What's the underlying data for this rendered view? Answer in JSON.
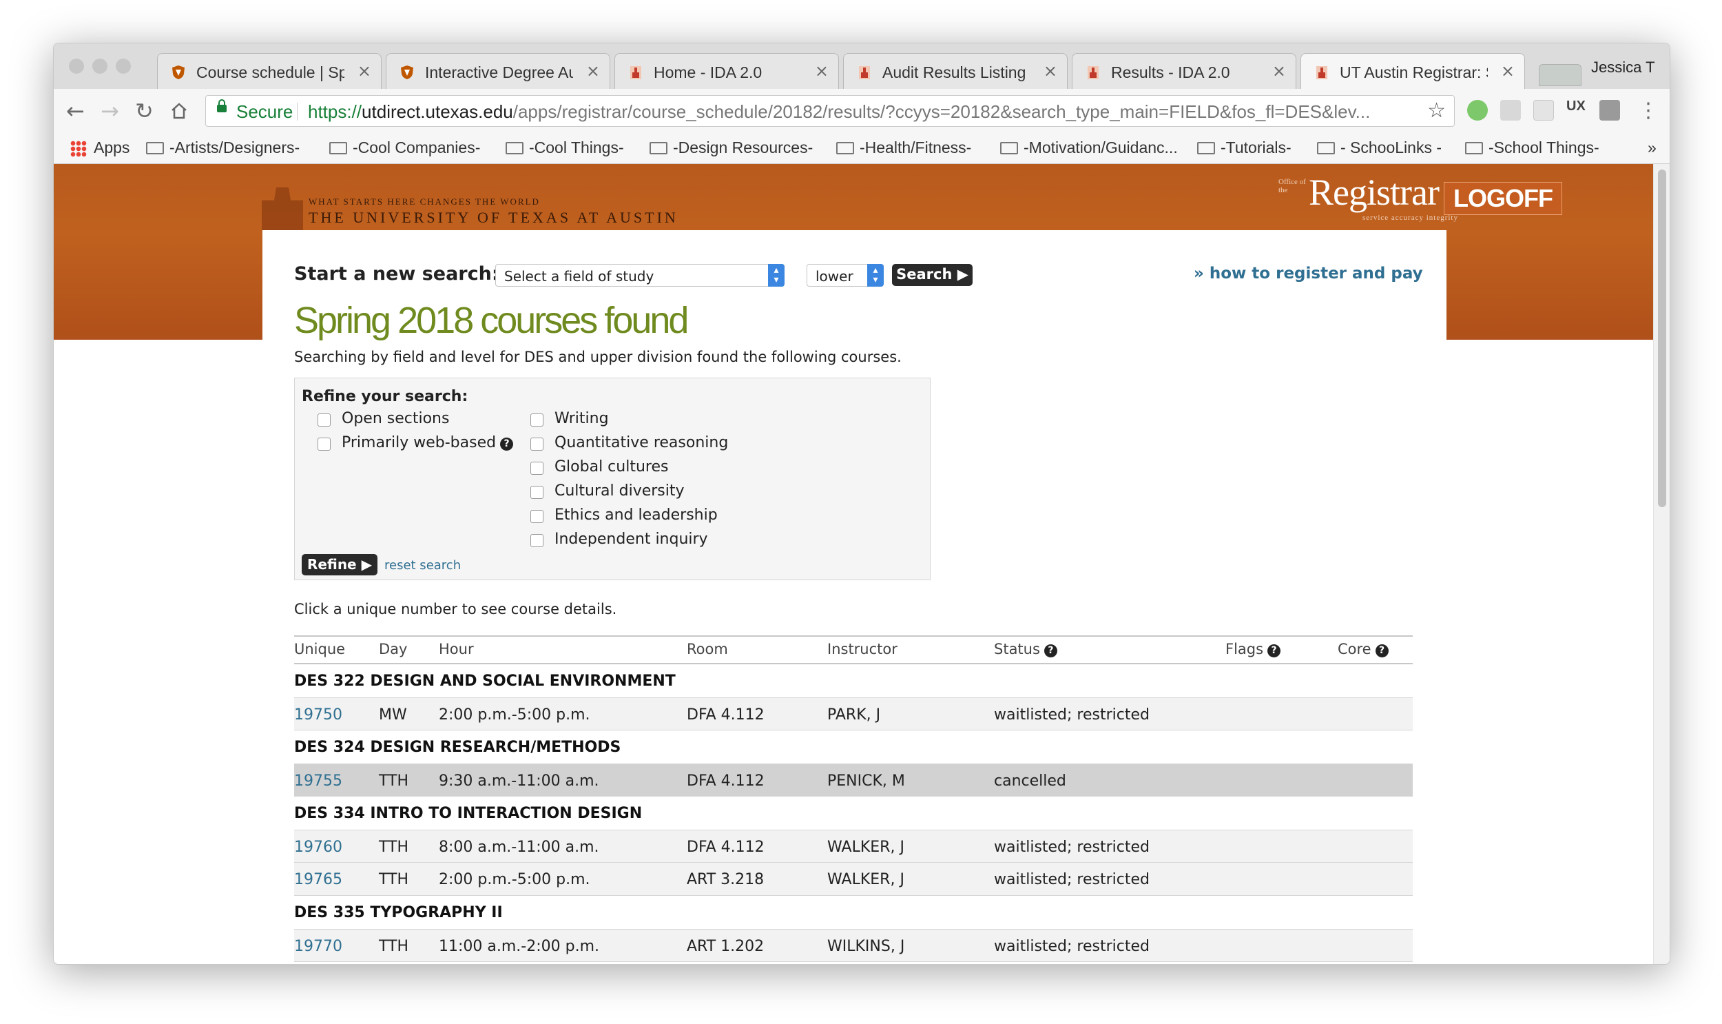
{
  "browser": {
    "tabs": [
      {
        "title": "Course schedule | Spr"
      },
      {
        "title": "Interactive Degree Au"
      },
      {
        "title": "Home - IDA 2.0"
      },
      {
        "title": "Audit Results Listing -"
      },
      {
        "title": "Results - IDA 2.0"
      },
      {
        "title": "UT Austin Registrar: S"
      }
    ],
    "tab_close": "×",
    "profile_name": "Jessica T",
    "secure_label": "Secure",
    "url_scheme": "https://",
    "url_domain": "utdirect.utexas.edu",
    "url_path": "/apps/registrar/course_schedule/20182/results/?ccyys=20182&search_type_main=FIELD&fos_fl=DES&lev...",
    "bookmarks": [
      "Apps",
      "-Artists/Designers-",
      "-Cool Companies-",
      "-Cool Things-",
      "-Design Resources-",
      "-Health/Fitness-",
      "-Motivation/Guidanc...",
      "-Tutorials-",
      "- SchooLinks -",
      "-School Things-"
    ],
    "bookmarks_more": "»"
  },
  "header": {
    "motto": "What Starts Here Changes The World",
    "university": "The University of Texas at Austin",
    "registrar_prefix": "Office of the",
    "registrar": "Registrar",
    "registrar_tagline": "service   accuracy   integrity",
    "logoff": "LOGOFF"
  },
  "search": {
    "label": "Start a new search:",
    "field_select": "Select a field of study",
    "level_select": "lower",
    "button": "Search ▶",
    "how_to": "» how to register and pay"
  },
  "results": {
    "title": "Spring 2018 courses found",
    "subtitle": "Searching by field and level for DES and upper division found the following courses."
  },
  "refine": {
    "title": "Refine your search:",
    "left_options": [
      "Open sections",
      "Primarily web-based"
    ],
    "right_options": [
      "Writing",
      "Quantitative reasoning",
      "Global cultures",
      "Cultural diversity",
      "Ethics and leadership",
      "Independent inquiry"
    ],
    "button": "Refine ▶",
    "reset": "reset search",
    "help_glyph": "?"
  },
  "note": "Click a unique number to see course details.",
  "table": {
    "headers": [
      "Unique",
      "Day",
      "Hour",
      "Room",
      "Instructor",
      "Status",
      "Flags",
      "Core"
    ],
    "courses": [
      {
        "title": "DES 322 DESIGN AND SOCIAL ENVIRONMENT",
        "sections": [
          {
            "unique": "19750",
            "day": "MW",
            "hour": "2:00 p.m.-5:00 p.m.",
            "room": "DFA 4.112",
            "instructor": "PARK, J",
            "status": "waitlisted; restricted"
          }
        ]
      },
      {
        "title": "DES 324 DESIGN RESEARCH/METHODS",
        "sections": [
          {
            "unique": "19755",
            "day": "TTH",
            "hour": "9:30 a.m.-11:00 a.m.",
            "room": "DFA 4.112",
            "instructor": "PENICK, M",
            "status": "cancelled"
          }
        ]
      },
      {
        "title": "DES 334 INTRO TO INTERACTION DESIGN",
        "sections": [
          {
            "unique": "19760",
            "day": "TTH",
            "hour": "8:00 a.m.-11:00 a.m.",
            "room": "DFA 4.112",
            "instructor": "WALKER, J",
            "status": "waitlisted; restricted"
          },
          {
            "unique": "19765",
            "day": "TTH",
            "hour": "2:00 p.m.-5:00 p.m.",
            "room": "ART 3.218",
            "instructor": "WALKER, J",
            "status": "waitlisted; restricted"
          }
        ]
      },
      {
        "title": "DES 335 TYPOGRAPHY II",
        "sections": [
          {
            "unique": "19770",
            "day": "TTH",
            "hour": "11:00 a.m.-2:00 p.m.",
            "room": "ART 1.202",
            "instructor": "WILKINS, J",
            "status": "waitlisted; restricted"
          }
        ]
      }
    ]
  },
  "colors": {
    "banner": "#c0611f",
    "title_green": "#6f8a1e",
    "link_blue": "#2f6f91",
    "secure_green": "#188038"
  }
}
